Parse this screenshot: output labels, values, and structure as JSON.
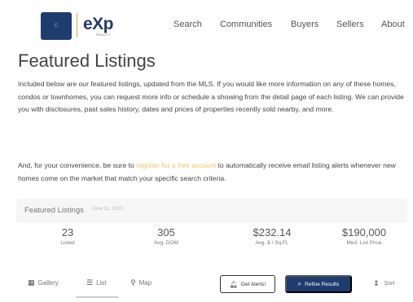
{
  "header": {
    "logo_left_text": "C",
    "logo_text": "eXp",
    "logo_sub": "REALTY",
    "nav": [
      "Search",
      "Communities",
      "Buyers",
      "Sellers",
      "About"
    ]
  },
  "title": "Featured Listings",
  "intro": {
    "text": "Included below are our featured listings, updated from the MLS. If you would like more information on any of these homes, condos or townhomes, you can request more info or schedule a showing from the detail page of each listing. We can provide you with disclosures, past sales history, dates and prices of properties recently sold nearby, and more."
  },
  "convenience": {
    "before": "And, for your convenience, be sure to ",
    "link": "register for a free account",
    "after": " to automatically receive email listing alerts whenever new homes come on the market that match your specific search criteria."
  },
  "summary": {
    "label": "Featured Listings",
    "date": "June 11, 2020"
  },
  "stats": [
    {
      "value": "23",
      "caption": "Listed"
    },
    {
      "value": "305",
      "caption": "Avg. DOM"
    },
    {
      "value": "$232.14",
      "caption": "Avg. $ / Sq.Ft."
    },
    {
      "value": "$190,000",
      "caption": "Med. List Price"
    }
  ],
  "tabs": {
    "gallery": "Gallery",
    "list": "List",
    "map": "Map"
  },
  "actions": {
    "alert": "Get Alerts!",
    "refine": "Refine Results",
    "sort": "Sort"
  },
  "colors": {
    "brand_navy": "#1f3c6e",
    "accent_gold": "#e2a14a",
    "link": "#f2c16a"
  },
  "icons": {
    "gallery": "grid-icon",
    "list": "list-icon",
    "map": "map-pin-icon",
    "alert": "bell-icon",
    "refine": "search-icon",
    "sort": "sort-icon"
  }
}
